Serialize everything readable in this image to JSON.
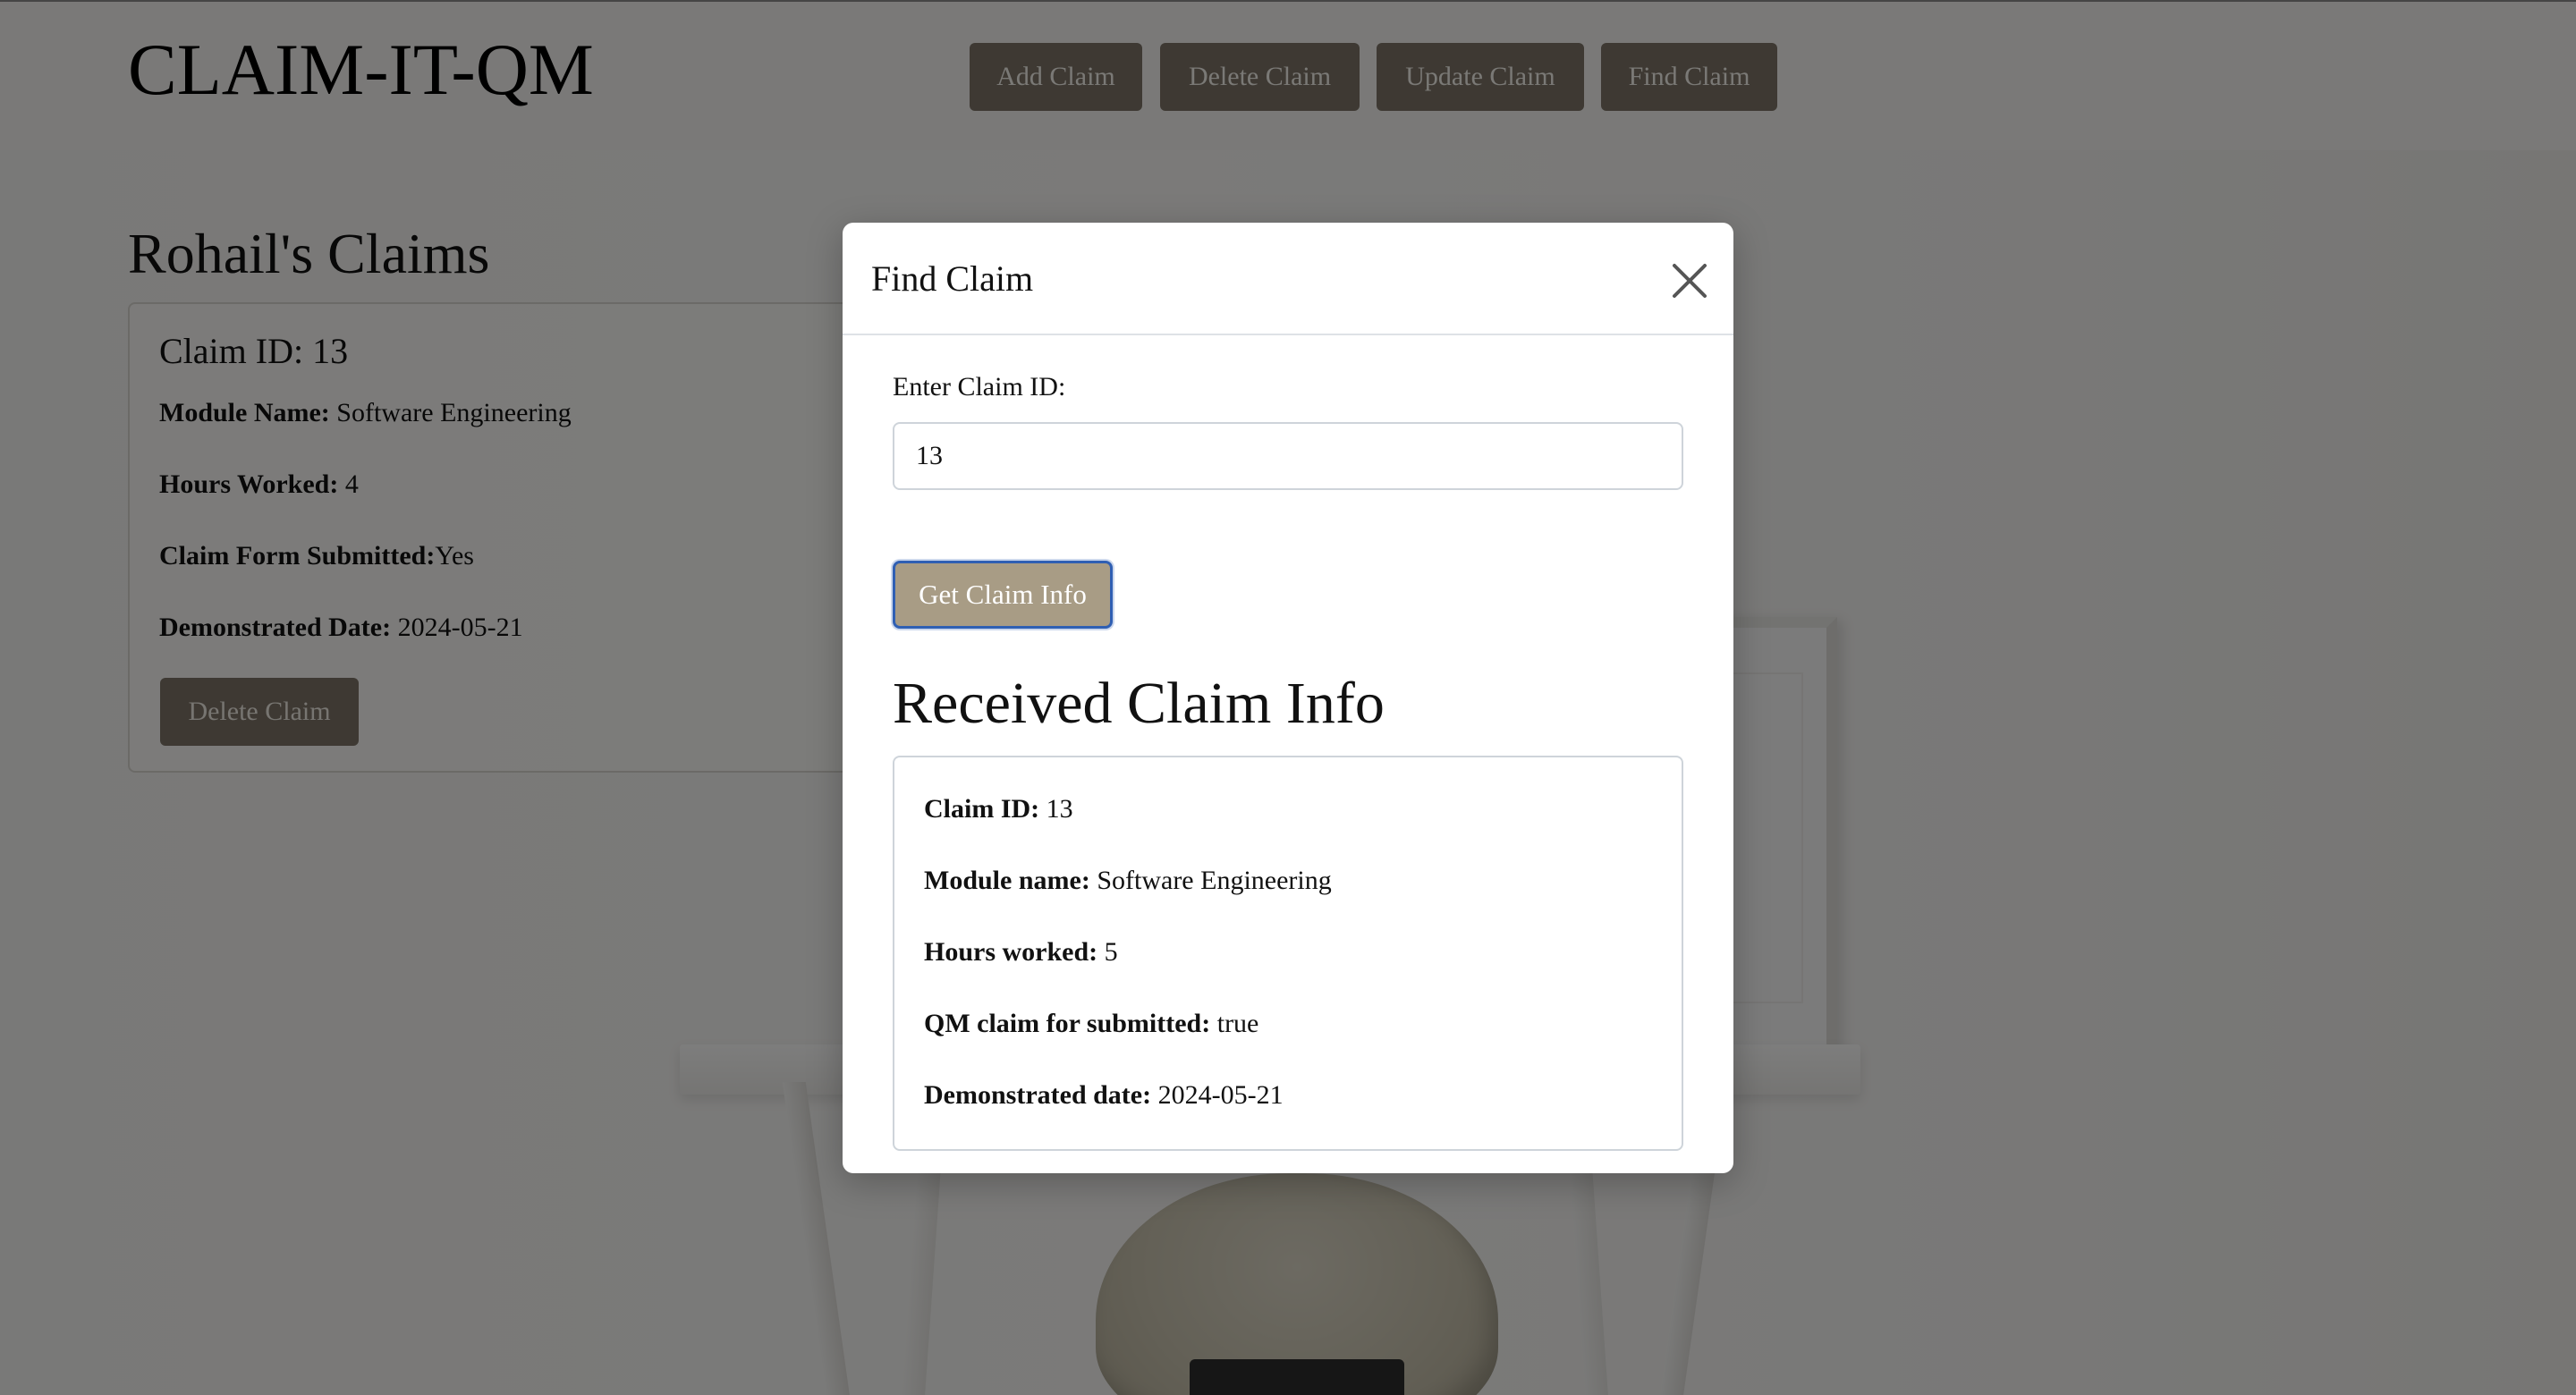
{
  "app": {
    "title": "CLAIM-IT-QM"
  },
  "nav": {
    "add_label": "Add Claim",
    "delete_label": "Delete Claim",
    "update_label": "Update Claim",
    "find_label": "Find Claim"
  },
  "claims_section": {
    "title": "Rohail's Claims",
    "cards": [
      {
        "title": "Claim ID: 13",
        "module_label": "Module Name:",
        "module_value": " Software Engineering",
        "hours_label": "Hours Worked:",
        "hours_value": " 4",
        "form_label": "Claim Form Submitted:",
        "form_value": "Yes",
        "date_label": "Demonstrated Date:",
        "date_value": " 2024-05-21",
        "delete_label": "Delete Claim"
      }
    ]
  },
  "modal": {
    "title": "Find Claim",
    "field_label": "Enter Claim ID:",
    "input_value": "13",
    "submit_label": "Get Claim Info",
    "result_heading": "Received Claim Info",
    "result": {
      "id_label": "Claim ID:",
      "id_value": " 13",
      "module_label": "Module name:",
      "module_value": " Software Engineering",
      "hours_label": "Hours worked:",
      "hours_value": " 5",
      "submitted_label": "QM claim for submitted:",
      "submitted_value": " true",
      "date_label": "Demonstrated date:",
      "date_value": " 2024-05-21"
    }
  },
  "colors": {
    "nav_button_bg": "#7c7366",
    "primary_button_bg": "#a89c85",
    "focus_ring": "#2f5fb3",
    "backdrop": "rgba(0,0,0,0.5)"
  },
  "icons": {
    "close": "close-icon"
  }
}
